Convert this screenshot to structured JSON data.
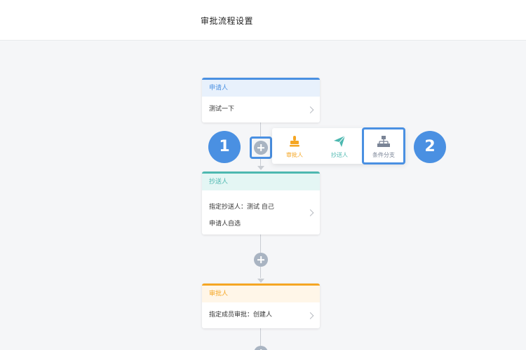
{
  "header": {
    "title": "审批流程设置"
  },
  "nodes": {
    "applicant": {
      "label": "申请人",
      "content": "测试一下"
    },
    "cc": {
      "label": "抄送人",
      "line1": "指定抄送人：测试 自己",
      "line2": "申请人自选"
    },
    "approver": {
      "label": "审批人",
      "content": "指定成员审批：创建人"
    }
  },
  "add_menu": {
    "items": [
      {
        "label": "审批人",
        "icon": "stamp-icon",
        "color": "#f5a623"
      },
      {
        "label": "抄送人",
        "icon": "paper-plane-icon",
        "color": "#4db8b0"
      },
      {
        "label": "条件分支",
        "icon": "branch-icon",
        "color": "#7a8496"
      }
    ]
  },
  "annotations": {
    "badge_1": "1",
    "badge_2": "2"
  },
  "colors": {
    "accent": "#4a90e2",
    "approver": "#f5a623",
    "cc": "#4db8b0",
    "add_button": "#a9b4c2"
  }
}
